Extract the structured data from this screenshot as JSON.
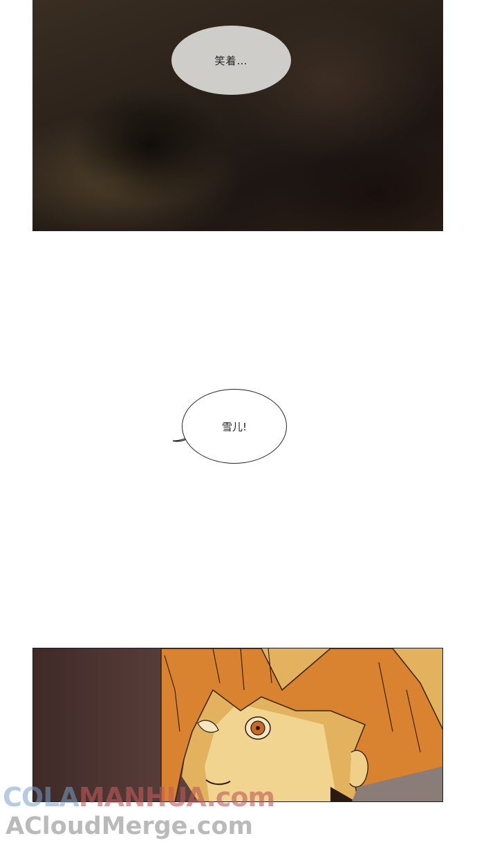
{
  "panels": {
    "top": {
      "bubble_text": "笑着…"
    },
    "middle": {
      "bubble_text": "雪儿!"
    },
    "bottom": {}
  },
  "watermarks": {
    "line1_part1": "COLA",
    "line1_part2": "MANHUA.com",
    "line2": "ACloudMerge.com"
  }
}
